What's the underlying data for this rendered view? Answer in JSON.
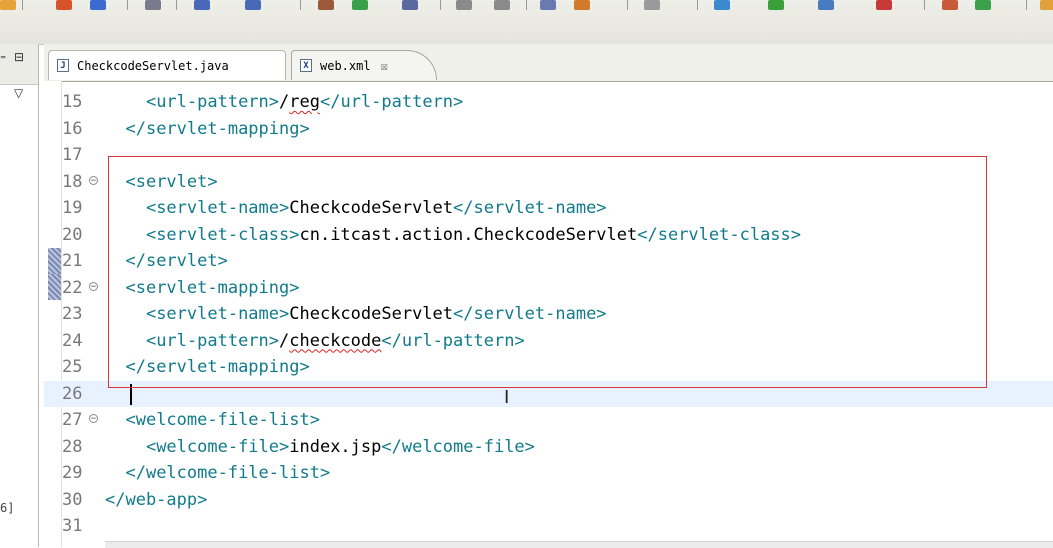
{
  "tabs": [
    {
      "label": "CheckcodeServlet.java",
      "icon": "java-file-icon",
      "icon_glyph": "J"
    },
    {
      "label": "web.xml",
      "icon": "xml-file-icon",
      "icon_glyph": "X",
      "close": "☒"
    }
  ],
  "left_panel": {
    "fragment": "6]",
    "btn_min": "⁼",
    "btn_max": "⊟",
    "btn_menu": "▽"
  },
  "editor": {
    "highlight_color": "#d23a3a",
    "lines": [
      {
        "n": "15",
        "indent": "    ",
        "open": "<url-pattern>",
        "text": "/reg",
        "close": "</url-pattern>",
        "squig": "reg"
      },
      {
        "n": "16",
        "indent": "  ",
        "open": "</servlet-mapping>"
      },
      {
        "n": "17",
        "indent": ""
      },
      {
        "n": "18",
        "indent": "  ",
        "open": "<servlet>",
        "fold": true
      },
      {
        "n": "19",
        "indent": "    ",
        "open": "<servlet-name>",
        "text": "CheckcodeServlet",
        "close": "</servlet-name>"
      },
      {
        "n": "20",
        "indent": "    ",
        "open": "<servlet-class>",
        "text": "cn.itcast.action.CheckcodeServlet",
        "close": "</servlet-class>"
      },
      {
        "n": "21",
        "indent": "  ",
        "open": "</servlet>"
      },
      {
        "n": "22",
        "indent": "  ",
        "open": "<servlet-mapping>",
        "fold": true
      },
      {
        "n": "23",
        "indent": "    ",
        "open": "<servlet-name>",
        "text": "CheckcodeServlet",
        "close": "</servlet-name>"
      },
      {
        "n": "24",
        "indent": "    ",
        "open": "<url-pattern>",
        "text": "/checkcode",
        "close": "</url-pattern>",
        "squig": "checkcode"
      },
      {
        "n": "25",
        "indent": "  ",
        "open": "</servlet-mapping>"
      },
      {
        "n": "26",
        "indent": "",
        "current": true
      },
      {
        "n": "27",
        "indent": "  ",
        "open": "<welcome-file-list>",
        "fold": true
      },
      {
        "n": "28",
        "indent": "    ",
        "open": "<welcome-file>",
        "text": "index.jsp",
        "close": "</welcome-file>"
      },
      {
        "n": "29",
        "indent": "  ",
        "open": "</welcome-file-list>"
      },
      {
        "n": "30",
        "indent": "",
        "open": "</web-app>"
      },
      {
        "n": "31",
        "indent": ""
      }
    ]
  }
}
